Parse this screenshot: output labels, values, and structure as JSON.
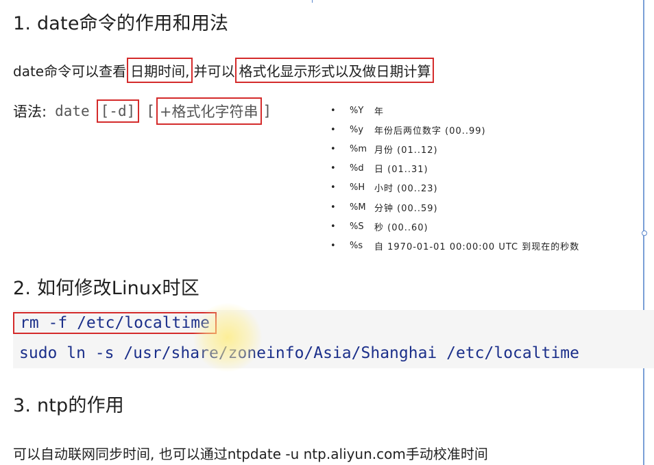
{
  "sections": {
    "s1_title": "1. date命令的作用和用法",
    "s2_title": "2. 如何修改Linux时区",
    "s3_title": "3. ntp的作用"
  },
  "description": {
    "prefix": "date命令可以查看",
    "box1": "日期时间,",
    "middle": "并可以",
    "box2": "格式化显示形式以及做日期计算"
  },
  "syntax": {
    "label": "语法:",
    "command": "date",
    "option": "[-d]",
    "open_bracket": "[",
    "format": "+格式化字符串",
    "close_bracket": "]"
  },
  "format_specs": [
    {
      "bullet": "•",
      "code": "%Y",
      "meaning": "年"
    },
    {
      "bullet": "•",
      "code": "%y",
      "meaning": "年份后两位数字 (00..99)"
    },
    {
      "bullet": "•",
      "code": "%m",
      "meaning": "月份 (01..12)"
    },
    {
      "bullet": "•",
      "code": "%d",
      "meaning": "日 (01..31)"
    },
    {
      "bullet": "•",
      "code": "%H",
      "meaning": "小时 (00..23)"
    },
    {
      "bullet": "•",
      "code": "%M",
      "meaning": "分钟 (00..59)"
    },
    {
      "bullet": "•",
      "code": "%S",
      "meaning": "秒 (00..60)"
    },
    {
      "bullet": "•",
      "code": "%s",
      "meaning": "自 1970-01-01 00:00:00 UTC 到现在的秒数"
    }
  ],
  "code": {
    "line1": "rm -f /etc/localtime",
    "line2": "sudo ln -s /usr/share/zoneinfo/Asia/Shanghai /etc/localtime"
  },
  "ntp_description": "可以自动联网同步时间, 也可以通过ntpdate -u ntp.aliyun.com手动校准时间",
  "colors": {
    "box_border": "#d42a2a",
    "code_text": "#1b2f8a",
    "code_bg": "#f5f5f5",
    "highlight": "#ffec78"
  }
}
